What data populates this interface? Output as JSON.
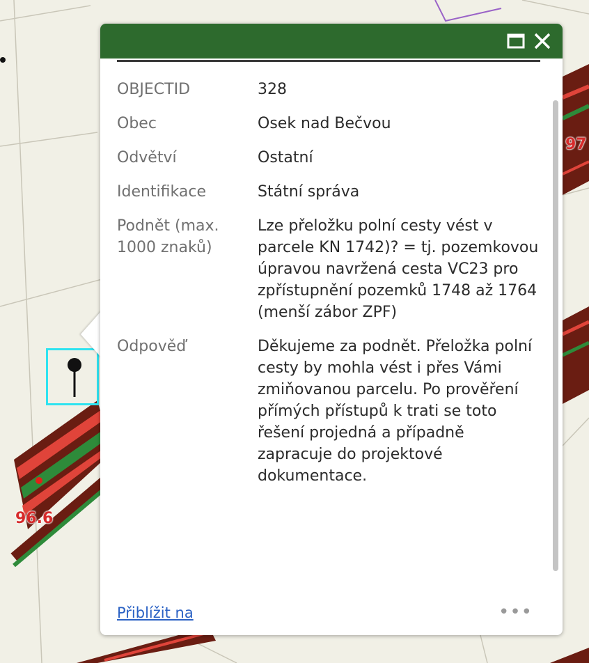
{
  "map": {
    "labels": {
      "left_measure": "96.6",
      "right_measure": "97"
    },
    "colors": {
      "background": "#f1f0e6",
      "track_dark": "#6a1d12",
      "track_red": "#e0443a",
      "track_green": "#2e8b3a",
      "selection": "#2fe3f0",
      "label": "#d62a2a"
    }
  },
  "popup": {
    "header_color": "#2d6a2d",
    "icons": {
      "maximize": "maximize-icon",
      "close": "close-icon"
    },
    "attributes": [
      {
        "key": "OBJECTID",
        "value": "328"
      },
      {
        "key": "Obec",
        "value": "Osek nad Bečvou"
      },
      {
        "key": "Odvětví",
        "value": "Ostatní"
      },
      {
        "key": "Identifikace",
        "value": "Státní správa"
      },
      {
        "key": "Podnět (max. 1000 znaků)",
        "value": "Lze přeložku polní cesty vést v parcele KN 1742)? = tj. pozemkovou úpravou navržená cesta VC23 pro zpřístupnění pozemků 1748 až 1764 (menší zábor ZPF)"
      },
      {
        "key": "Odpověď",
        "value": "Děkujeme za podnět. Přeložka polní cesty by mohla vést i přes Vámi zmiňovanou parcelu. Po prověření přímých přístupů k trati se toto řešení projedná a případně zapracuje do projektové dokumentace."
      }
    ],
    "footer": {
      "zoom_label": "Přiblížit na",
      "more_label": "•••"
    }
  }
}
